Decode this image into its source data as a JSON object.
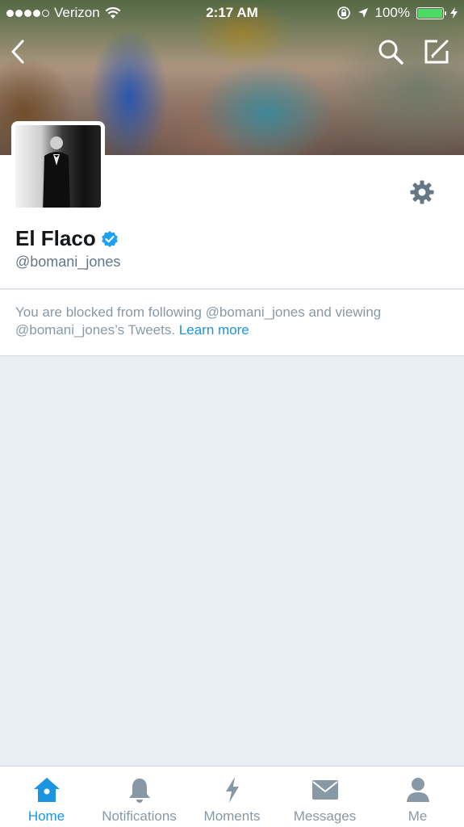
{
  "status_bar": {
    "carrier": "Verizon",
    "time": "2:17 AM",
    "battery_percent": "100%",
    "battery_level": 1.0
  },
  "profile": {
    "display_name": "El Flaco",
    "handle": "@bomani_jones",
    "verified": true
  },
  "notice": {
    "text": "You are blocked from following @bomani_jones and viewing @bomani_jones’s Tweets.",
    "link_label": "Learn more"
  },
  "tabs": [
    {
      "label": "Home",
      "icon": "home-icon",
      "active": true
    },
    {
      "label": "Notifications",
      "icon": "bell-icon",
      "active": false
    },
    {
      "label": "Moments",
      "icon": "lightning-icon",
      "active": false
    },
    {
      "label": "Messages",
      "icon": "envelope-icon",
      "active": false
    },
    {
      "label": "Me",
      "icon": "person-icon",
      "active": false
    }
  ],
  "colors": {
    "accent": "#1b95e0",
    "inactive_tab": "#8899a6",
    "verified_badge": "#1da1f2",
    "battery_fill": "#4cd964"
  }
}
